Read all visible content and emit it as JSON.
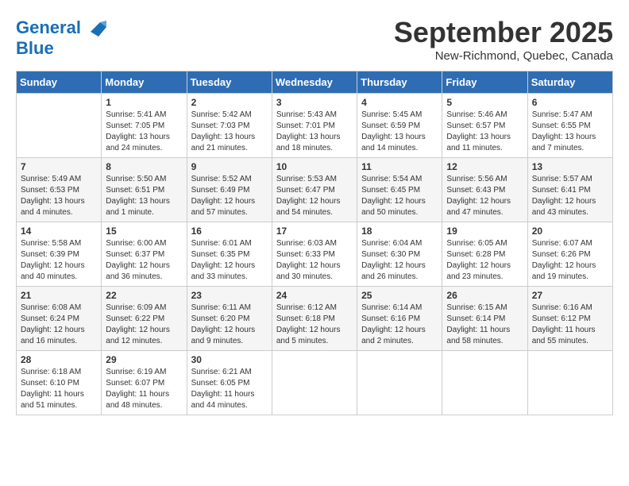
{
  "header": {
    "logo_line1": "General",
    "logo_line2": "Blue",
    "month": "September 2025",
    "location": "New-Richmond, Quebec, Canada"
  },
  "days_of_week": [
    "Sunday",
    "Monday",
    "Tuesday",
    "Wednesday",
    "Thursday",
    "Friday",
    "Saturday"
  ],
  "weeks": [
    [
      {
        "day": "",
        "info": ""
      },
      {
        "day": "1",
        "info": "Sunrise: 5:41 AM\nSunset: 7:05 PM\nDaylight: 13 hours\nand 24 minutes."
      },
      {
        "day": "2",
        "info": "Sunrise: 5:42 AM\nSunset: 7:03 PM\nDaylight: 13 hours\nand 21 minutes."
      },
      {
        "day": "3",
        "info": "Sunrise: 5:43 AM\nSunset: 7:01 PM\nDaylight: 13 hours\nand 18 minutes."
      },
      {
        "day": "4",
        "info": "Sunrise: 5:45 AM\nSunset: 6:59 PM\nDaylight: 13 hours\nand 14 minutes."
      },
      {
        "day": "5",
        "info": "Sunrise: 5:46 AM\nSunset: 6:57 PM\nDaylight: 13 hours\nand 11 minutes."
      },
      {
        "day": "6",
        "info": "Sunrise: 5:47 AM\nSunset: 6:55 PM\nDaylight: 13 hours\nand 7 minutes."
      }
    ],
    [
      {
        "day": "7",
        "info": "Sunrise: 5:49 AM\nSunset: 6:53 PM\nDaylight: 13 hours\nand 4 minutes."
      },
      {
        "day": "8",
        "info": "Sunrise: 5:50 AM\nSunset: 6:51 PM\nDaylight: 13 hours\nand 1 minute."
      },
      {
        "day": "9",
        "info": "Sunrise: 5:52 AM\nSunset: 6:49 PM\nDaylight: 12 hours\nand 57 minutes."
      },
      {
        "day": "10",
        "info": "Sunrise: 5:53 AM\nSunset: 6:47 PM\nDaylight: 12 hours\nand 54 minutes."
      },
      {
        "day": "11",
        "info": "Sunrise: 5:54 AM\nSunset: 6:45 PM\nDaylight: 12 hours\nand 50 minutes."
      },
      {
        "day": "12",
        "info": "Sunrise: 5:56 AM\nSunset: 6:43 PM\nDaylight: 12 hours\nand 47 minutes."
      },
      {
        "day": "13",
        "info": "Sunrise: 5:57 AM\nSunset: 6:41 PM\nDaylight: 12 hours\nand 43 minutes."
      }
    ],
    [
      {
        "day": "14",
        "info": "Sunrise: 5:58 AM\nSunset: 6:39 PM\nDaylight: 12 hours\nand 40 minutes."
      },
      {
        "day": "15",
        "info": "Sunrise: 6:00 AM\nSunset: 6:37 PM\nDaylight: 12 hours\nand 36 minutes."
      },
      {
        "day": "16",
        "info": "Sunrise: 6:01 AM\nSunset: 6:35 PM\nDaylight: 12 hours\nand 33 minutes."
      },
      {
        "day": "17",
        "info": "Sunrise: 6:03 AM\nSunset: 6:33 PM\nDaylight: 12 hours\nand 30 minutes."
      },
      {
        "day": "18",
        "info": "Sunrise: 6:04 AM\nSunset: 6:30 PM\nDaylight: 12 hours\nand 26 minutes."
      },
      {
        "day": "19",
        "info": "Sunrise: 6:05 AM\nSunset: 6:28 PM\nDaylight: 12 hours\nand 23 minutes."
      },
      {
        "day": "20",
        "info": "Sunrise: 6:07 AM\nSunset: 6:26 PM\nDaylight: 12 hours\nand 19 minutes."
      }
    ],
    [
      {
        "day": "21",
        "info": "Sunrise: 6:08 AM\nSunset: 6:24 PM\nDaylight: 12 hours\nand 16 minutes."
      },
      {
        "day": "22",
        "info": "Sunrise: 6:09 AM\nSunset: 6:22 PM\nDaylight: 12 hours\nand 12 minutes."
      },
      {
        "day": "23",
        "info": "Sunrise: 6:11 AM\nSunset: 6:20 PM\nDaylight: 12 hours\nand 9 minutes."
      },
      {
        "day": "24",
        "info": "Sunrise: 6:12 AM\nSunset: 6:18 PM\nDaylight: 12 hours\nand 5 minutes."
      },
      {
        "day": "25",
        "info": "Sunrise: 6:14 AM\nSunset: 6:16 PM\nDaylight: 12 hours\nand 2 minutes."
      },
      {
        "day": "26",
        "info": "Sunrise: 6:15 AM\nSunset: 6:14 PM\nDaylight: 11 hours\nand 58 minutes."
      },
      {
        "day": "27",
        "info": "Sunrise: 6:16 AM\nSunset: 6:12 PM\nDaylight: 11 hours\nand 55 minutes."
      }
    ],
    [
      {
        "day": "28",
        "info": "Sunrise: 6:18 AM\nSunset: 6:10 PM\nDaylight: 11 hours\nand 51 minutes."
      },
      {
        "day": "29",
        "info": "Sunrise: 6:19 AM\nSunset: 6:07 PM\nDaylight: 11 hours\nand 48 minutes."
      },
      {
        "day": "30",
        "info": "Sunrise: 6:21 AM\nSunset: 6:05 PM\nDaylight: 11 hours\nand 44 minutes."
      },
      {
        "day": "",
        "info": ""
      },
      {
        "day": "",
        "info": ""
      },
      {
        "day": "",
        "info": ""
      },
      {
        "day": "",
        "info": ""
      }
    ]
  ]
}
